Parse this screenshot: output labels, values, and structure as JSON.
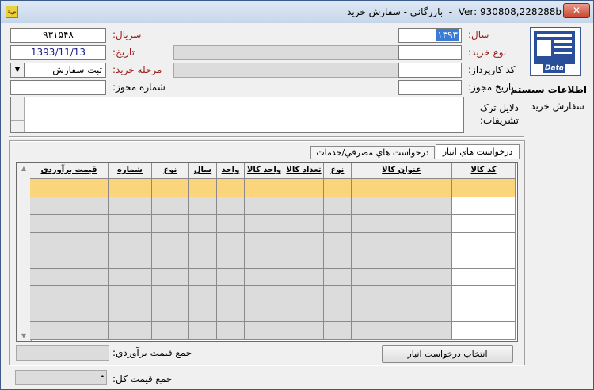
{
  "window": {
    "title": "بازرگاني - سفارش خريد",
    "version": "Ver: 930808,228288b",
    "close": "✕",
    "app_icon": "ﻲﺛ"
  },
  "colors": {
    "highlight_row": "#fbd57c",
    "selected_text_bg": "#3a7bd5"
  },
  "form": {
    "serial_label": "سريال:",
    "serial_value": "۹۳۱۵۴۸",
    "date_label": "تاريخ:",
    "date_value": "1393/11/13",
    "stage_label": "مرحله خريد:",
    "stage_value": "ثبت سفارش",
    "license_no_label": "شماره مجوز:",
    "year_label": "سال:",
    "year_value": "۱۳۹۳",
    "purchase_type_label": "نوع خريد:",
    "user_code_label": "كد كارپرداز:",
    "license_date_label": "تاريخ مجوز:",
    "reasons_label": "دلايل ترک تشريفات:"
  },
  "sidebar": {
    "icon_text": "Data",
    "system_info": "اطلاعات سيستم",
    "module": "سفارش خريد"
  },
  "tabs": [
    {
      "label": "درخواست هاي انبار"
    },
    {
      "label": "درخواست هاي مصرفي/خدمات"
    }
  ],
  "grid": {
    "columns": [
      "كد كالا",
      "عنوان كالا",
      "نوع",
      "تعداد كالا",
      "واحد كالا",
      "واحد",
      "سال",
      "نوع",
      "شماره",
      "قيمت برآوردي"
    ],
    "scroll_up": "▲",
    "scroll_down": "▼"
  },
  "footer": {
    "select_button": "انتخاب درخواست انبار",
    "sum_estimated_label": "جمع قيمت برآوردي:",
    "total_label": "جمع قيمت كل:"
  }
}
